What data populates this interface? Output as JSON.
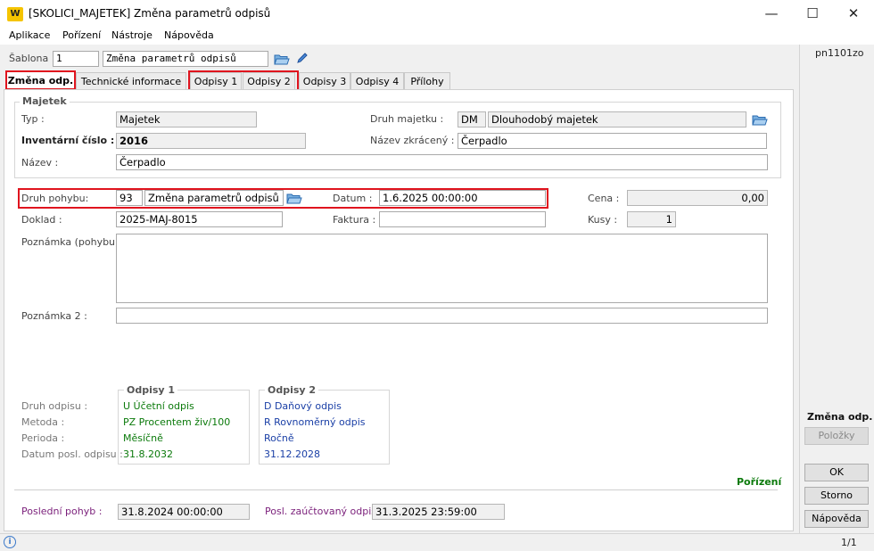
{
  "window": {
    "app_logo": "W",
    "title": "[SKOLICI_MAJETEK] Změna parametrů odpisů",
    "minimize": "—",
    "maximize": "☐",
    "close": "✕"
  },
  "menu": [
    "Aplikace",
    "Pořízení",
    "Nástroje",
    "Nápověda"
  ],
  "template": {
    "label": "Šablona :",
    "number": "1",
    "name": "Změna parametrů odpisů"
  },
  "tabs": [
    "Změna odp.",
    "Technické informace",
    "Odpisy 1",
    "Odpisy 2",
    "Odpisy 3",
    "Odpisy 4",
    "Přílohy"
  ],
  "asset": {
    "group_title": "Majetek",
    "type_label": "Typ :",
    "type_value": "Majetek",
    "inv_label": "Inventární číslo :",
    "inv_value": "2016",
    "name_label": "Název :",
    "name_value": "Čerpadlo",
    "kind_label": "Druh majetku :",
    "kind_code": "DM",
    "kind_name": "Dlouhodobý majetek",
    "short_label": "Název zkrácený :",
    "short_value": "Čerpadlo"
  },
  "movement": {
    "type_label": "Druh pohybu:",
    "type_code": "93",
    "type_name": "Změna parametrů odpisů",
    "date_label": "Datum :",
    "date_value": "1.6.2025 00:00:00",
    "price_label": "Cena :",
    "price_value": "0,00",
    "doc_label": "Doklad :",
    "doc_value": "2025-MAJ-8015",
    "invoice_label": "Faktura :",
    "invoice_value": "",
    "qty_label": "Kusy :",
    "qty_value": "1",
    "note_label": "Poznámka (pohybu) :",
    "note_value": "",
    "note2_label": "Poznámka 2 :",
    "note2_value": ""
  },
  "depreciation": {
    "labels": [
      "Druh odpisu :",
      "Metoda :",
      "Perioda :",
      "Datum posl. odpisu :"
    ],
    "d1": {
      "title": "Odpisy 1",
      "kind": "U  Účetní odpis",
      "method": "PZ  Procentem živ/100",
      "period": "Měsíčně",
      "last_date": "31.8.2032"
    },
    "d2": {
      "title": "Odpisy 2",
      "kind": "D  Daňový odpis",
      "method": "R  Rovnoměrný odpis",
      "period": "Ročně",
      "last_date": "31.12.2028"
    }
  },
  "footer": {
    "last_move_label": "Poslední pohyb :",
    "last_move_value": "31.8.2024 00:00:00",
    "last_posted_label": "Posl. zaúčtovaný odpis :",
    "last_posted_value": "31.3.2025 23:59:00",
    "state": "Pořízení"
  },
  "side": {
    "code": "pn1101zo",
    "mode": "Změna odp.",
    "items_button": "Položky",
    "ok": "OK",
    "cancel": "Storno",
    "help": "Nápověda"
  },
  "status": {
    "info": "i",
    "page": "1/1"
  },
  "colors": {
    "highlight": "#e0141e",
    "green_text": "#0b7a0b",
    "blue_text": "#1a3fa6",
    "purple_text": "#7a1f7a"
  }
}
